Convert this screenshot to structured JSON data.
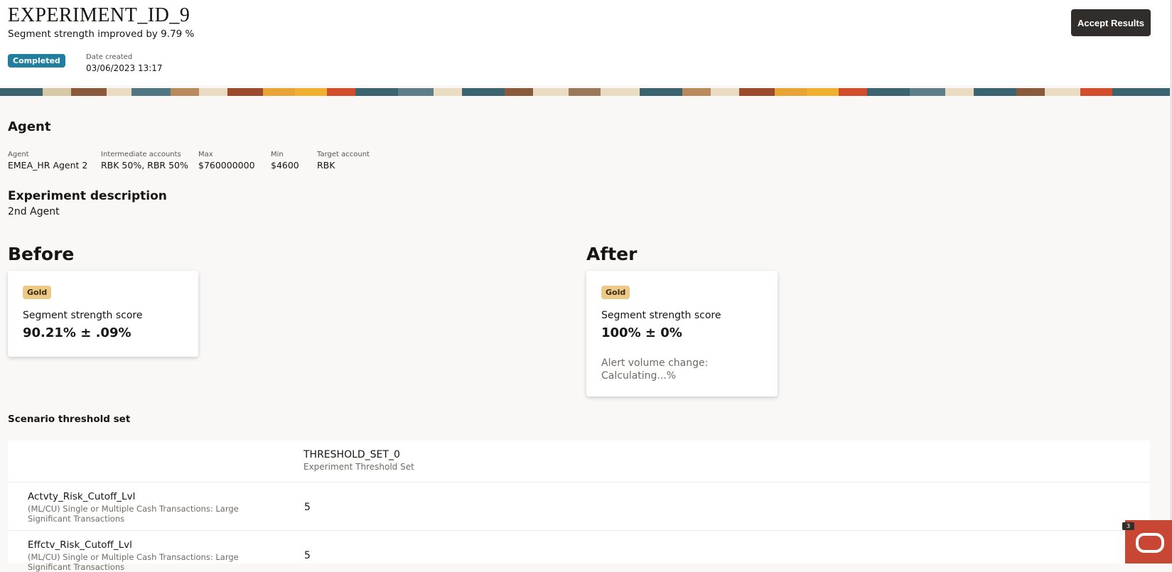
{
  "header": {
    "title": "EXPERIMENT_ID_9",
    "subtitle": "Segment strength improved by 9.79 %",
    "status": "Completed",
    "date_label": "Date created",
    "date_value": "03/06/2023 13:17",
    "accept_label": "Accept Results"
  },
  "agent": {
    "title": "Agent",
    "fields": [
      {
        "label": "Agent",
        "value": "EMEA_HR Agent 2"
      },
      {
        "label": "Intermediate accounts",
        "value": "RBK 50%, RBR 50%"
      },
      {
        "label": "Max",
        "value": "$760000000"
      },
      {
        "label": "Min",
        "value": "$4600"
      },
      {
        "label": "Target account",
        "value": "RBK"
      }
    ]
  },
  "description": {
    "title": "Experiment description",
    "value": "2nd Agent"
  },
  "before": {
    "title": "Before",
    "badge": "Gold",
    "score_label": "Segment strength score",
    "score_value": "90.21% ± .09%"
  },
  "after": {
    "title": "After",
    "badge": "Gold",
    "score_label": "Segment strength score",
    "score_value": "100% ± 0%",
    "alert_line1": "Alert volume change:",
    "alert_line2": "Calculating...%"
  },
  "scenario": {
    "title": "Scenario threshold set",
    "column_name": "THRESHOLD_SET_0",
    "column_sub": "Experiment Threshold Set",
    "rows": [
      {
        "name": "Actvty_Risk_Cutoff_Lvl",
        "desc": "(ML/CU) Single or Multiple Cash Transactions: Large Significant Transactions",
        "value": "5"
      },
      {
        "name": "Effctv_Risk_Cutoff_Lvl",
        "desc": "(ML/CU) Single or Multiple Cash Transactions: Large Significant Transactions",
        "value": "5"
      }
    ]
  },
  "widget": {
    "count": "3"
  },
  "colors": {
    "accent_button": "#312d2a",
    "status_badge": "#227e9e",
    "gold_badge": "#edc987",
    "chat_widget": "#c74634",
    "page_bg": "#f9f8f6"
  }
}
